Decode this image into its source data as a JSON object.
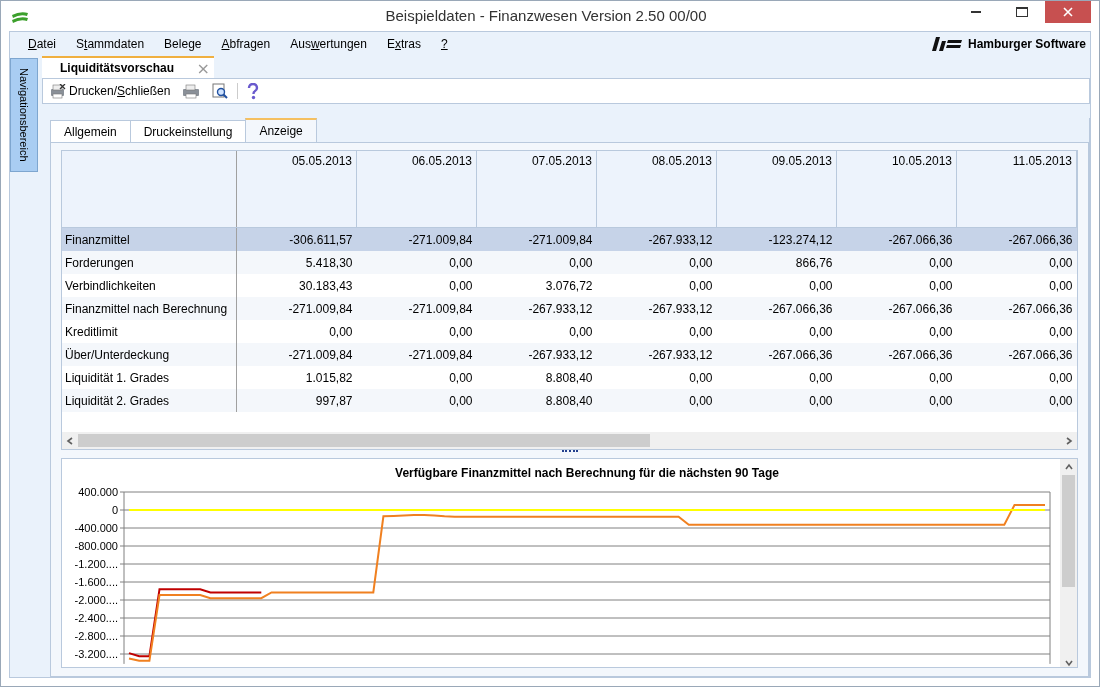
{
  "window": {
    "title": "Beispieldaten - Finanzwesen Version 2.50 00/00"
  },
  "menu": [
    {
      "key": "D",
      "post": "atei"
    },
    {
      "pre": "S",
      "key": "t",
      "post": "ammdaten"
    },
    {
      "pre": "Bele",
      "key": "g",
      "post": "e"
    },
    {
      "key": "A",
      "post": "bfragen"
    },
    {
      "pre": "Aus",
      "key": "w",
      "post": "ertungen"
    },
    {
      "pre": "E",
      "key": "x",
      "post": "tras"
    },
    {
      "key": "?"
    }
  ],
  "brand": "Hamburger Software",
  "navigation": {
    "label": "Navigationsbereich"
  },
  "document_tab": {
    "label": "Liquiditätsvorschau",
    "close": "×"
  },
  "toolbar": {
    "print_close": {
      "pre": "Drucken/",
      "key": "S",
      "post": "chließen"
    }
  },
  "tabs": [
    {
      "label": "Allgemein",
      "selected": false
    },
    {
      "label": "Druckeinstellung",
      "selected": false
    },
    {
      "label": "Anzeige",
      "selected": true
    }
  ],
  "table": {
    "columns": [
      "05.05.2013",
      "06.05.2013",
      "07.05.2013",
      "08.05.2013",
      "09.05.2013",
      "10.05.2013",
      "11.05.2013"
    ],
    "rows": [
      {
        "label": "Finanzmittel",
        "selected": true,
        "cells": [
          "-306.611,57",
          "-271.009,84",
          "-271.009,84",
          "-267.933,12",
          "-123.274,12",
          "-267.066,36",
          "-267.066,36"
        ]
      },
      {
        "label": "Forderungen",
        "selected": false,
        "cells": [
          "5.418,30",
          "0,00",
          "0,00",
          "0,00",
          "866,76",
          "0,00",
          "0,00"
        ]
      },
      {
        "label": "Verbindlichkeiten",
        "selected": false,
        "cells": [
          "30.183,43",
          "0,00",
          "3.076,72",
          "0,00",
          "0,00",
          "0,00",
          "0,00"
        ]
      },
      {
        "label": "Finanzmittel nach Berechnung",
        "selected": false,
        "cells": [
          "-271.009,84",
          "-271.009,84",
          "-267.933,12",
          "-267.933,12",
          "-267.066,36",
          "-267.066,36",
          "-267.066,36"
        ]
      },
      {
        "label": "Kreditlimit",
        "selected": false,
        "cells": [
          "0,00",
          "0,00",
          "0,00",
          "0,00",
          "0,00",
          "0,00",
          "0,00"
        ]
      },
      {
        "label": "Über/Unterdeckung",
        "selected": false,
        "cells": [
          "-271.009,84",
          "-271.009,84",
          "-267.933,12",
          "-267.933,12",
          "-267.066,36",
          "-267.066,36",
          "-267.066,36"
        ]
      },
      {
        "label": "Liquidität 1. Grades",
        "selected": false,
        "cells": [
          "1.015,82",
          "0,00",
          "8.808,40",
          "0,00",
          "0,00",
          "0,00",
          "0,00"
        ]
      },
      {
        "label": "Liquidität 2. Grades",
        "selected": false,
        "cells": [
          "997,87",
          "0,00",
          "8.808,40",
          "0,00",
          "0,00",
          "0,00",
          "0,00"
        ]
      }
    ]
  },
  "chart": {
    "chart_data": {
      "type": "line",
      "title": "Verfügbare Finanzmittel nach Berechnung für die nächsten 90 Tage",
      "categories": [
        null,
        null,
        null,
        null,
        null,
        null,
        null,
        null,
        null,
        null,
        null,
        null,
        null,
        null,
        null,
        null,
        null,
        null,
        null,
        null,
        null,
        null,
        null,
        null,
        null,
        null,
        null,
        null,
        null,
        null,
        null,
        null,
        null,
        null,
        null,
        null,
        null,
        null,
        null,
        null,
        null,
        null,
        null,
        null,
        null,
        null,
        null,
        null,
        null,
        null,
        null,
        null,
        null,
        null,
        null,
        null,
        null,
        null,
        null,
        null,
        null,
        null,
        null,
        null,
        null,
        null,
        null,
        null,
        null,
        null,
        null,
        null,
        null,
        null,
        null,
        null,
        null,
        null,
        null,
        null,
        null,
        null,
        null,
        null,
        null,
        null,
        null,
        null,
        null,
        null,
        null
      ],
      "ylim": [
        -3420000,
        400000
      ],
      "grid": true,
      "yticks": [
        {
          "value": 400000,
          "label": "400.000"
        },
        {
          "value": 0,
          "label": "0"
        },
        {
          "value": -400000,
          "label": "-400.000"
        },
        {
          "value": -800000,
          "label": "-800.000"
        },
        {
          "value": -1200000,
          "label": "-1.200...."
        },
        {
          "value": -1600000,
          "label": "-1.600...."
        },
        {
          "value": -2000000,
          "label": "-2.000...."
        },
        {
          "value": -2400000,
          "label": "-2.400...."
        },
        {
          "value": -2800000,
          "label": "-2.800...."
        },
        {
          "value": -3200000,
          "label": "-3.200...."
        }
      ],
      "series": [
        {
          "color": "#c00000",
          "values": [
            -3180000,
            -3250000,
            -3250000,
            -1760000,
            -1760000,
            -1760000,
            -1760000,
            -1760000,
            -1830000,
            -1830000,
            -1830000,
            -1830000,
            -1830000,
            -1830000,
            null,
            null,
            null,
            null,
            null,
            null,
            null,
            null,
            null,
            null,
            null,
            null,
            null,
            null,
            null,
            null,
            null,
            null,
            null,
            null,
            null,
            null,
            null,
            null,
            null,
            null,
            null,
            null,
            null,
            null,
            null,
            null,
            null,
            null,
            null,
            null,
            null,
            null,
            null,
            null,
            null,
            null,
            null,
            null,
            null,
            null,
            null,
            null,
            null,
            null,
            null,
            null,
            null,
            null,
            null,
            null,
            null,
            null,
            null,
            null,
            null,
            null,
            null,
            null,
            null,
            null,
            null,
            null,
            null,
            null,
            null,
            null,
            null,
            null,
            null,
            null,
            null
          ]
        },
        {
          "color": "#f08020",
          "values": [
            -3300000,
            -3350000,
            -3350000,
            -1890000,
            -1890000,
            -1890000,
            -1890000,
            -1890000,
            -1960000,
            -1960000,
            -1960000,
            -1960000,
            -1960000,
            -1960000,
            -1830000,
            -1830000,
            -1830000,
            -1830000,
            -1830000,
            -1830000,
            -1830000,
            -1830000,
            -1830000,
            -1830000,
            -1830000,
            -140000,
            -130000,
            -120000,
            -110000,
            -110000,
            -120000,
            -140000,
            -150000,
            -150000,
            -150000,
            -150000,
            -150000,
            -150000,
            -150000,
            -150000,
            -150000,
            -150000,
            -150000,
            -150000,
            -150000,
            -150000,
            -150000,
            -150000,
            -150000,
            -150000,
            -150000,
            -150000,
            -150000,
            -150000,
            -150000,
            -330000,
            -330000,
            -330000,
            -330000,
            -330000,
            -330000,
            -330000,
            -330000,
            -330000,
            -330000,
            -330000,
            -330000,
            -330000,
            -330000,
            -330000,
            -330000,
            -330000,
            -330000,
            -330000,
            -330000,
            -330000,
            -330000,
            -330000,
            -330000,
            -330000,
            -330000,
            -330000,
            -330000,
            -330000,
            -330000,
            -330000,
            -330000,
            110000,
            110000,
            110000,
            110000
          ]
        },
        {
          "color": "#ffff00",
          "values": [
            0,
            0,
            0,
            0,
            0,
            0,
            0,
            0,
            0,
            0,
            0,
            0,
            0,
            0,
            0,
            0,
            0,
            0,
            0,
            0,
            0,
            0,
            0,
            0,
            0,
            0,
            0,
            0,
            0,
            0,
            0,
            0,
            0,
            0,
            0,
            0,
            0,
            0,
            0,
            0,
            0,
            0,
            0,
            0,
            0,
            0,
            0,
            0,
            0,
            0,
            0,
            0,
            0,
            0,
            0,
            0,
            0,
            0,
            0,
            0,
            0,
            0,
            0,
            0,
            0,
            0,
            0,
            0,
            0,
            0,
            0,
            0,
            0,
            0,
            0,
            0,
            0,
            0,
            0,
            0,
            0,
            0,
            0,
            0,
            0,
            0,
            0,
            0,
            0,
            0,
            0
          ]
        }
      ]
    }
  }
}
